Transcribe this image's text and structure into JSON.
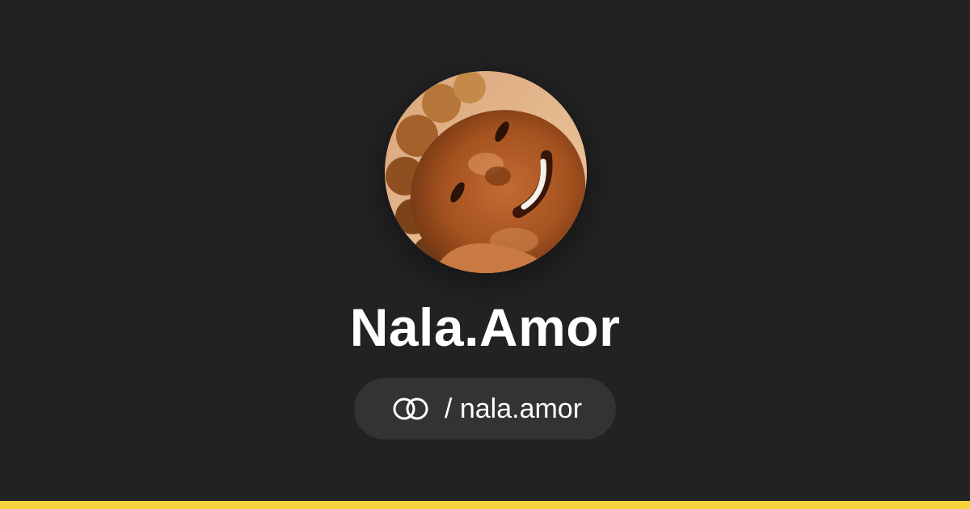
{
  "profile": {
    "name": "Nala.Amor",
    "handle": "/ nala.amor",
    "avatar_icon": "avatar-photo"
  },
  "icons": {
    "link": "linked-rings-icon"
  },
  "colors": {
    "background": "#222222",
    "pill": "#333333",
    "text": "#ffffff",
    "accent_bar": "#f5d33b"
  }
}
